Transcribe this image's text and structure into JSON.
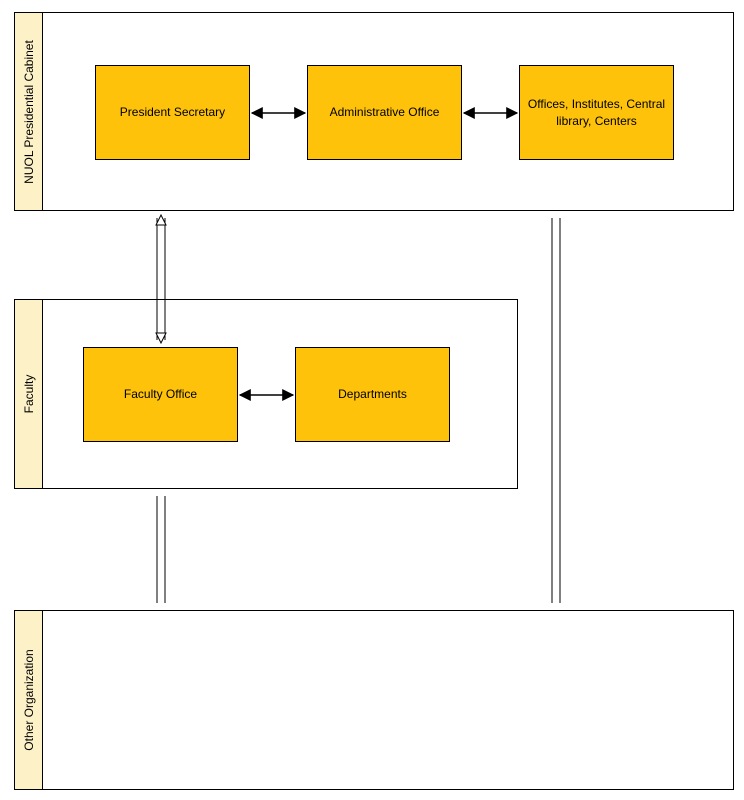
{
  "containers": {
    "cabinet": {
      "label": "NUOL Presidential Cabinet"
    },
    "faculty": {
      "label": "Faculty"
    },
    "other": {
      "label": "Other Organization"
    }
  },
  "boxes": {
    "president_secretary": "President Secretary",
    "administrative_office": "Administrative Office",
    "offices_institutes": "Offices, Institutes, Central library, Centers",
    "faculty_office": "Faculty Office",
    "departments": "Departments"
  },
  "chart_data": {
    "type": "org-flow",
    "nodes": [
      {
        "id": "president_secretary",
        "label": "President Secretary",
        "group": "NUOL Presidential Cabinet"
      },
      {
        "id": "administrative_office",
        "label": "Administrative Office",
        "group": "NUOL Presidential Cabinet"
      },
      {
        "id": "offices_institutes",
        "label": "Offices, Institutes, Central library, Centers",
        "group": "NUOL Presidential Cabinet"
      },
      {
        "id": "faculty_office",
        "label": "Faculty Office",
        "group": "Faculty"
      },
      {
        "id": "departments",
        "label": "Departments",
        "group": "Faculty"
      }
    ],
    "groups": [
      {
        "id": "cabinet",
        "label": "NUOL Presidential Cabinet"
      },
      {
        "id": "faculty",
        "label": "Faculty"
      },
      {
        "id": "other",
        "label": "Other Organization"
      }
    ],
    "edges": [
      {
        "from": "president_secretary",
        "to": "administrative_office",
        "style": "solid",
        "bidirectional": true
      },
      {
        "from": "administrative_office",
        "to": "offices_institutes",
        "style": "solid",
        "bidirectional": true
      },
      {
        "from": "faculty_office",
        "to": "departments",
        "style": "solid",
        "bidirectional": true
      },
      {
        "from": "president_secretary",
        "to": "faculty_office",
        "style": "hollow",
        "bidirectional": true
      },
      {
        "from": "offices_institutes",
        "to": "other",
        "style": "hollow",
        "bidirectional": true
      },
      {
        "from": "faculty_office",
        "to": "other",
        "style": "hollow",
        "bidirectional": true
      }
    ]
  }
}
